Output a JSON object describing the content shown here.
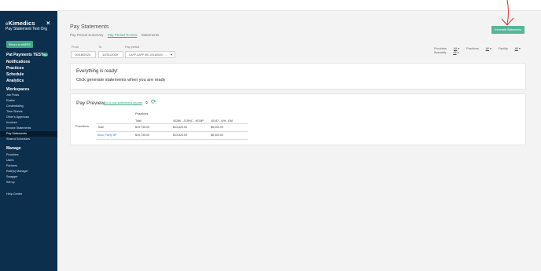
{
  "sidebar": {
    "brand_prefix": "e",
    "brand": "Kimedics",
    "close": "×",
    "org": "Pay Statement Test Org",
    "return_button": "Return to eMERS",
    "pay_payments": "Pat Payments TEST",
    "badge": "99+",
    "main_nav": [
      "Notifications",
      "Practices",
      "Schedule",
      "Analytics"
    ],
    "workspaces_title": "Workspaces",
    "workspaces": [
      "Job Posts",
      "Roster",
      "Credentialing",
      "Time Sheets",
      "Other's Approvals",
      "Invoices",
      "Invoice Statements",
      "Pay Statements",
      "Shared Schedules"
    ],
    "active_workspace": "Pay Statements",
    "manage_title": "Manage",
    "manage": [
      "Providers",
      "Users",
      "Partners",
      "Rate(s) Manager",
      "Swagger",
      "Set up"
    ],
    "help": "Help Center"
  },
  "header": {
    "title": "Pay Statements",
    "breadcrumb": [
      "Pay Period Summary",
      "Pay Period To-Dos",
      "Statements"
    ],
    "generate_button": "Generate Statements"
  },
  "form": {
    "from_label": "From",
    "from_value": "10/16/2020",
    "to_label": "To",
    "to_value": "10/31/2020",
    "pay_period_label": "Pay period",
    "pay_period_value": "CAPP-UAPP WD 10/16/2020 - ..."
  },
  "filters": {
    "providers_label": "Providers",
    "providers_value": "All",
    "practices_label": "Practices",
    "practices_value": "All",
    "facility_label": "Facility",
    "facility_value": "All",
    "specialty_label": "Specialty",
    "specialty_value": "All"
  },
  "ready": {
    "heading": "Everything is ready!",
    "message": "Click generate statements when you are ready"
  },
  "preview": {
    "title": "Pay Preview",
    "link": "Go to pay statements reports",
    "practices_header": "Practices",
    "providers_header": "Providers",
    "columns": [
      "Total",
      "40286 - JCRHC - NGNP",
      "40147 - WH - EM"
    ],
    "rows": [
      {
        "provider": "Total",
        "cells": [
          "$19,735.00",
          "$13,825.00",
          "$6,000.00"
        ]
      },
      {
        "provider": "Buck, Harry NP",
        "cells": [
          "$19,735.00",
          "$13,825.00",
          "$6,000.00"
        ]
      }
    ]
  },
  "colors": {
    "sidebar": "#0c2f4e",
    "accent": "#3fa687",
    "arrow": "#e0302a"
  }
}
